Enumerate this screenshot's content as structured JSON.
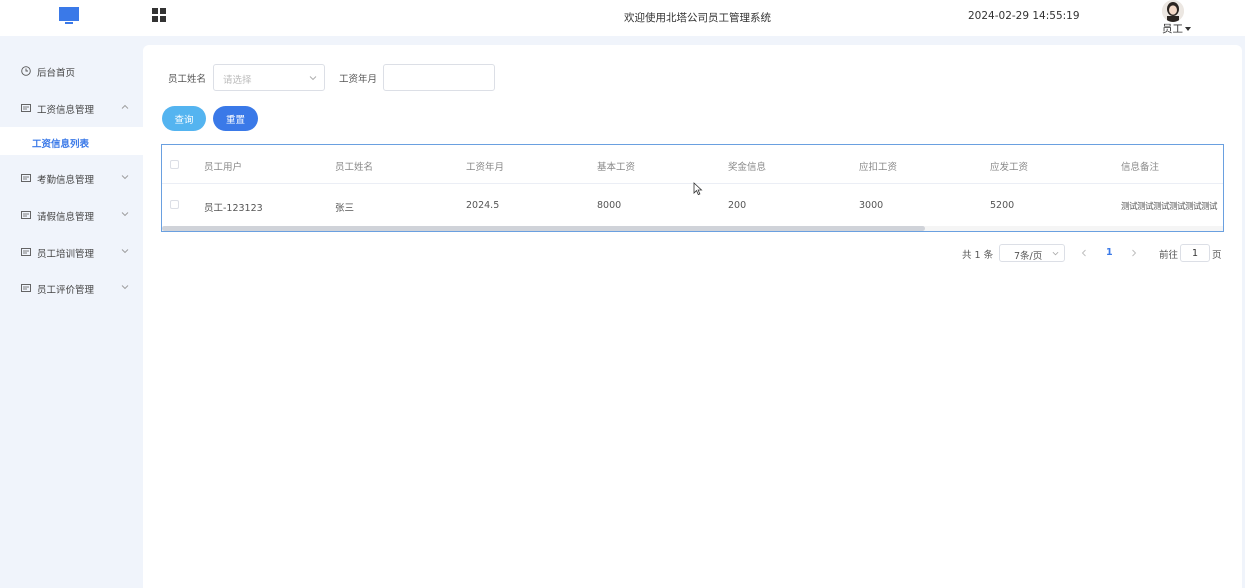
{
  "header": {
    "logo_icon": "monitor-icon",
    "grid_icon": "grid-icon",
    "welcome": "欢迎使用北塔公司员工管理系统",
    "datetime": "2024-02-29 14:55:19",
    "user_label": "员工"
  },
  "sidebar": {
    "items": [
      {
        "label": "后台首页",
        "icon": "clock-icon"
      },
      {
        "label": "工资信息管理",
        "icon": "card-icon",
        "expanded": true
      },
      {
        "label": "考勤信息管理",
        "icon": "card-icon"
      },
      {
        "label": "请假信息管理",
        "icon": "card-icon"
      },
      {
        "label": "员工培训管理",
        "icon": "card-icon"
      },
      {
        "label": "员工评价管理",
        "icon": "card-icon"
      }
    ],
    "sub_item": "工资信息列表"
  },
  "filter": {
    "name_label": "员工姓名",
    "name_placeholder": "请选择",
    "month_label": "工资年月",
    "month_value": ""
  },
  "buttons": {
    "query": "查询",
    "reset": "重置"
  },
  "table": {
    "headers": [
      "员工用户",
      "员工姓名",
      "工资年月",
      "基本工资",
      "奖金信息",
      "应扣工资",
      "应发工资",
      "信息备注"
    ],
    "rows": [
      [
        "员工-123123",
        "张三",
        "2024.5",
        "8000",
        "200",
        "3000",
        "5200",
        "测试测试测试测试测试测试"
      ]
    ]
  },
  "pagination": {
    "total": "共 1 条",
    "page_size": "7条/页",
    "current_page": "1",
    "goto_label": "前往",
    "goto_value": "1",
    "page_suffix": "页"
  },
  "colors": {
    "primary": "#3a79e8",
    "query_button": "#54b4f0",
    "background": "#f0f4fb"
  }
}
